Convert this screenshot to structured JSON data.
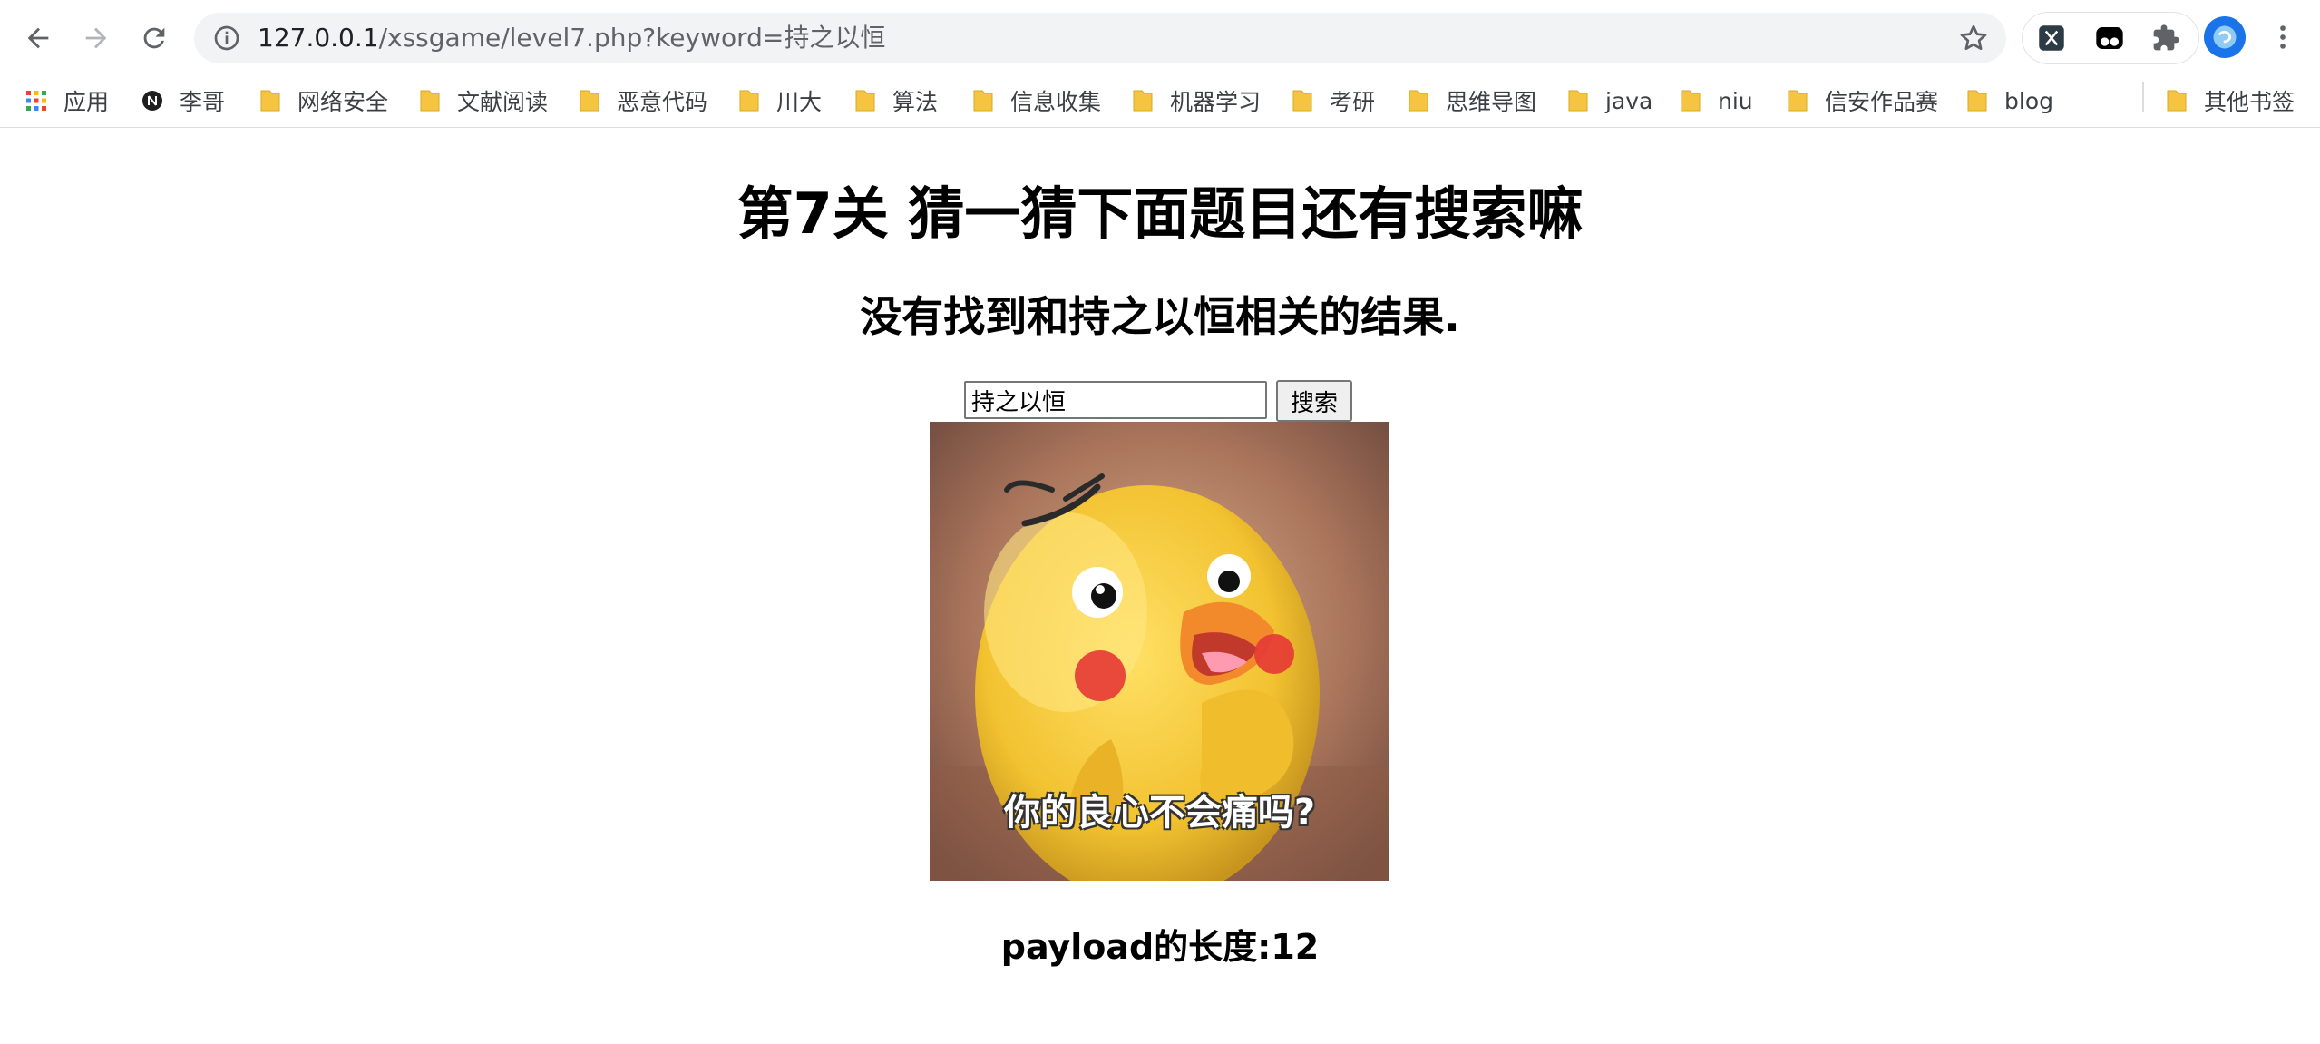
{
  "browser": {
    "url_host": "127.0.0.1",
    "url_path": "/xssgame/level7.php?keyword=持之以恒"
  },
  "bookmarks": [
    {
      "label": "应用",
      "icon": "apps-grid-icon"
    },
    {
      "label": "李哥",
      "icon": "notion-icon"
    },
    {
      "label": "网络安全",
      "icon": "folder-icon"
    },
    {
      "label": "文献阅读",
      "icon": "folder-icon"
    },
    {
      "label": "恶意代码",
      "icon": "folder-icon"
    },
    {
      "label": "川大",
      "icon": "folder-icon"
    },
    {
      "label": "算法",
      "icon": "folder-icon"
    },
    {
      "label": "信息收集",
      "icon": "folder-icon"
    },
    {
      "label": "机器学习",
      "icon": "folder-icon"
    },
    {
      "label": "考研",
      "icon": "folder-icon"
    },
    {
      "label": "思维导图",
      "icon": "folder-icon"
    },
    {
      "label": "java",
      "icon": "folder-icon"
    },
    {
      "label": "niu",
      "icon": "folder-icon"
    },
    {
      "label": "信安作品赛",
      "icon": "folder-icon"
    },
    {
      "label": "blog",
      "icon": "folder-icon"
    },
    {
      "label": "其他书签",
      "icon": "folder-icon"
    }
  ],
  "page": {
    "title": "第7关 猜一猜下面题目还有搜索嘛",
    "result_text": "没有找到和持之以恒相关的结果.",
    "search_value": "持之以恒",
    "search_button": "搜索",
    "image_caption": "你的良心不会痛吗?",
    "payload_length": "payload的长度:12"
  },
  "colors": {
    "folder": "#f5c542",
    "omnibox_bg": "#f1f3f4",
    "avatar": "#1a73e8"
  }
}
